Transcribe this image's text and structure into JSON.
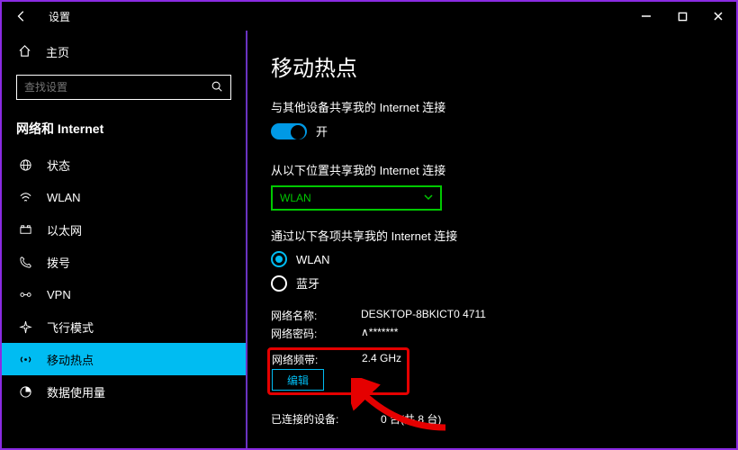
{
  "titlebar": {
    "title": "设置"
  },
  "home": {
    "label": "主页"
  },
  "search": {
    "placeholder": "查找设置"
  },
  "category": {
    "header": "网络和 Internet"
  },
  "sidebar": {
    "items": [
      {
        "label": "状态"
      },
      {
        "label": "WLAN"
      },
      {
        "label": "以太网"
      },
      {
        "label": "拨号"
      },
      {
        "label": "VPN"
      },
      {
        "label": "飞行模式"
      },
      {
        "label": "移动热点"
      },
      {
        "label": "数据使用量"
      }
    ]
  },
  "main": {
    "heading": "移动热点",
    "share_label": "与其他设备共享我的 Internet 连接",
    "toggle_state": "开",
    "share_from_label": "从以下位置共享我的 Internet 连接",
    "share_from_value": "WLAN",
    "share_over_label": "通过以下各项共享我的 Internet 连接",
    "radio_wlan": "WLAN",
    "radio_bt": "蓝牙",
    "net_name_k": "网络名称:",
    "net_name_v": "DESKTOP-8BKICT0 4711",
    "net_pwd_k": "网络密码:",
    "net_pwd_v": "∧*******",
    "net_band_k": "网络频带:",
    "net_band_v": "2.4 GHz",
    "edit_button": "编辑",
    "connected_k": "已连接的设备:",
    "connected_v": "0 台(共 8 台)"
  }
}
